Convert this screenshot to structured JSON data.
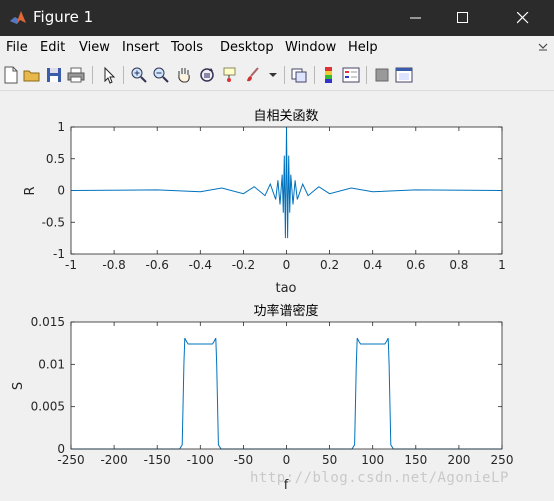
{
  "window": {
    "title": "Figure 1",
    "minimize_icon": "minimize-icon",
    "maximize_icon": "maximize-icon",
    "close_icon": "close-icon"
  },
  "menu": {
    "items": [
      "File",
      "Edit",
      "View",
      "Insert",
      "Tools",
      "Desktop",
      "Window",
      "Help"
    ],
    "overflow_icon": "chevron-icon"
  },
  "toolbar": {
    "icons": [
      "new-figure-icon",
      "open-file-icon",
      "save-icon",
      "print-icon",
      "edit-plot-icon",
      "zoom-in-icon",
      "zoom-out-icon",
      "pan-icon",
      "rotate-3d-icon",
      "data-cursor-icon",
      "brush-icon",
      "link-plot-icon",
      "colorbar-icon",
      "legend-icon",
      "hide-plot-tools-icon",
      "show-plot-tools-icon"
    ]
  },
  "watermark": "http://blog.csdn.net/AgonieLP",
  "chart_data": [
    {
      "type": "line",
      "title": "自相关函数",
      "xlabel": "tao",
      "ylabel": "R",
      "xlim": [
        -1,
        1
      ],
      "ylim": [
        -1,
        1
      ],
      "xticks": [
        "-1",
        "-0.8",
        "-0.6",
        "-0.4",
        "-0.2",
        "0",
        "0.2",
        "0.4",
        "0.6",
        "0.8",
        "1"
      ],
      "yticks": [
        "1",
        "0.5",
        "0",
        "-0.5",
        "-1"
      ],
      "color": "#0072bd",
      "series": [
        {
          "x": [
            -1,
            -0.6,
            -0.4,
            -0.3,
            -0.2,
            -0.15,
            -0.1,
            -0.075,
            -0.05,
            -0.04,
            -0.03,
            -0.02,
            -0.015,
            -0.01,
            -0.005,
            0,
            0.005,
            0.01,
            0.015,
            0.02,
            0.03,
            0.04,
            0.05,
            0.075,
            0.1,
            0.15,
            0.2,
            0.3,
            0.4,
            0.6,
            1
          ],
          "y": [
            0.0,
            0.01,
            -0.02,
            0.04,
            -0.05,
            0.06,
            -0.08,
            0.1,
            -0.14,
            0.16,
            -0.22,
            0.25,
            -0.35,
            0.55,
            -0.75,
            1.0,
            -0.75,
            0.55,
            -0.35,
            0.25,
            -0.22,
            0.16,
            -0.14,
            0.1,
            -0.08,
            0.06,
            -0.05,
            0.04,
            -0.02,
            0.01,
            0.0
          ]
        }
      ]
    },
    {
      "type": "line",
      "title": "功率谱密度",
      "xlabel": "f",
      "ylabel": "S",
      "xlim": [
        -250,
        250
      ],
      "ylim": [
        0,
        0.015
      ],
      "xticks": [
        "-250",
        "-200",
        "-150",
        "-100",
        "-50",
        "0",
        "50",
        "100",
        "150",
        "200",
        "250"
      ],
      "yticks": [
        "0.015",
        "0.01",
        "0.005",
        "0"
      ],
      "color": "#0072bd",
      "series": [
        {
          "x": [
            -250,
            -124,
            -121,
            -119,
            -118,
            -116,
            -114,
            -100,
            -86,
            -84,
            -82,
            -81,
            -79,
            -76,
            76,
            79,
            81,
            82,
            84,
            86,
            100,
            114,
            116,
            118,
            119,
            121,
            124,
            250
          ],
          "y": [
            0,
            0,
            0.0005,
            0.01,
            0.0131,
            0.0127,
            0.0124,
            0.0124,
            0.0124,
            0.0127,
            0.0131,
            0.01,
            0.0005,
            0,
            0,
            0.0005,
            0.01,
            0.0131,
            0.0127,
            0.0124,
            0.0124,
            0.0124,
            0.0127,
            0.0131,
            0.01,
            0.0005,
            0,
            0
          ]
        }
      ]
    }
  ]
}
